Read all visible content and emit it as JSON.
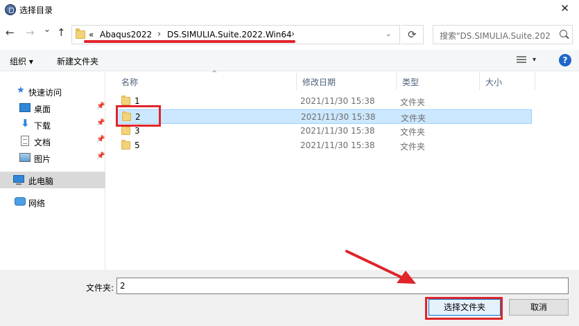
{
  "window": {
    "title": "选择目录",
    "close_glyph": "✕"
  },
  "nav": {
    "back_glyph": "←",
    "forward_glyph": "→",
    "history_glyph": "⌄",
    "up_glyph": "↑"
  },
  "address": {
    "overflow_glyph": "«",
    "crumbs": [
      "Abaqus2022",
      "DS.SIMULIA.Suite.2022.Win64"
    ],
    "separator": "›",
    "dropdown_glyph": "⌄",
    "refresh_glyph": "⟳"
  },
  "search": {
    "placeholder": "搜索\"DS.SIMULIA.Suite.202..."
  },
  "toolbar": {
    "organize": "组织 ▾",
    "new_folder": "新建文件夹",
    "view_dropdown": "▾",
    "help": "?"
  },
  "sidebar": {
    "items": [
      {
        "label": "快速访问",
        "icon": "star-icon"
      },
      {
        "label": "桌面",
        "icon": "desktop-icon",
        "pinned": true
      },
      {
        "label": "下载",
        "icon": "download-icon",
        "pinned": true
      },
      {
        "label": "文档",
        "icon": "document-icon",
        "pinned": true
      },
      {
        "label": "图片",
        "icon": "pictures-icon",
        "pinned": true
      },
      {
        "label": "此电脑",
        "icon": "computer-icon",
        "selected": true
      },
      {
        "label": "网络",
        "icon": "network-icon"
      }
    ],
    "pin_glyph": "📌"
  },
  "columns": {
    "name": "名称",
    "modified": "修改日期",
    "type": "类型",
    "size": "大小",
    "sort_glyph": "^"
  },
  "files": [
    {
      "name": "1",
      "modified": "2021/11/30 15:38",
      "type": "文件夹"
    },
    {
      "name": "2",
      "modified": "2021/11/30 15:38",
      "type": "文件夹",
      "selected": true
    },
    {
      "name": "3",
      "modified": "2021/11/30 15:38",
      "type": "文件夹"
    },
    {
      "name": "5",
      "modified": "2021/11/30 15:38",
      "type": "文件夹"
    }
  ],
  "footer": {
    "folder_label": "文件夹:",
    "folder_value": "2",
    "select_button": "选择文件夹",
    "cancel_button": "取消"
  },
  "colors": {
    "accent": "#0078d7",
    "selection": "#cce8ff",
    "annotation_red": "#e0242a",
    "folder": "#f3d27a"
  }
}
